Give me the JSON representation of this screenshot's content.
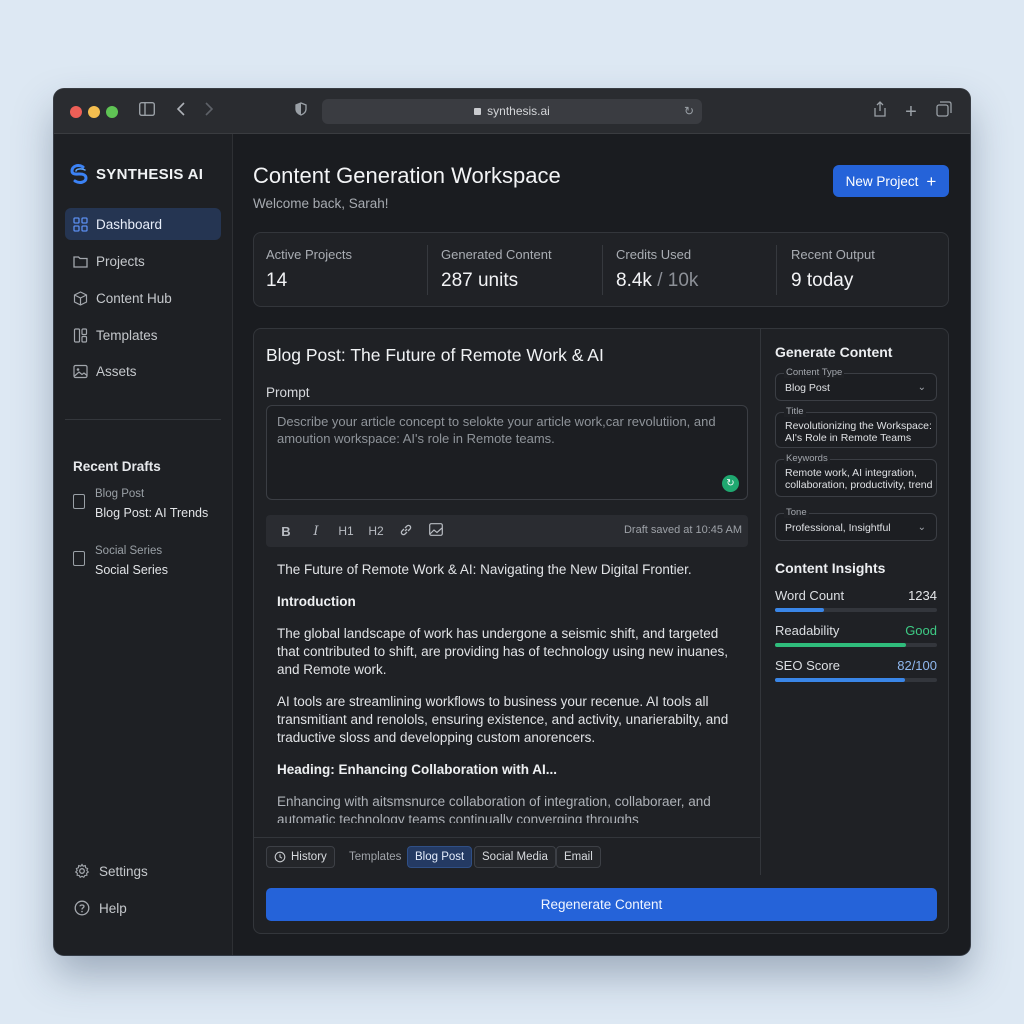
{
  "browser": {
    "url": "synthesis.ai",
    "traffic_lights": [
      "#ed5f57",
      "#f4be4f",
      "#5fc454"
    ]
  },
  "sidebar": {
    "brand": "SYNTHESIS AI",
    "nav": [
      {
        "label": "Dashboard",
        "icon": "grid-icon",
        "active": true
      },
      {
        "label": "Projects",
        "icon": "folder-icon",
        "active": false
      },
      {
        "label": "Content Hub",
        "icon": "cube-icon",
        "active": false
      },
      {
        "label": "Templates",
        "icon": "template-icon",
        "active": false
      },
      {
        "label": "Assets",
        "icon": "image-icon",
        "active": false
      }
    ],
    "recent_title": "Recent Drafts",
    "drafts": [
      {
        "kind": "Blog Post",
        "name": "Blog Post: AI Trends"
      },
      {
        "kind": "Social Series",
        "name": "Social Series"
      }
    ],
    "settings": "Settings",
    "help": "Help"
  },
  "header": {
    "title": "Content Generation Workspace",
    "subtitle": "Welcome back, Sarah!",
    "new_project": "New Project"
  },
  "stats": [
    {
      "label": "Active Projects",
      "value": "14",
      "suffix": ""
    },
    {
      "label": "Generated Content",
      "value": "287 units",
      "suffix": ""
    },
    {
      "label": "Credits Used",
      "value": "8.4k",
      "suffix": " / 10k"
    },
    {
      "label": "Recent Output",
      "value": "9 today",
      "suffix": ""
    }
  ],
  "editor": {
    "title": "Blog Post: The Future of Remote Work & AI",
    "prompt_label": "Prompt",
    "prompt_placeholder": "Describe your article concept to selokte your article work,car revolutiion, and amoution workspace: AI's role in Remote teams.",
    "saved_status": "Draft saved at 10:45 AM",
    "paragraphs": [
      {
        "style": "normal",
        "text": "The Future of Remote Work & AI: Navigating the New Digital Frontier."
      },
      {
        "style": "heading",
        "text": "Introduction"
      },
      {
        "style": "normal",
        "text": "The global landscape of work has undergone a seismic shift, and targeted that contributed to shift, are providing has of technology using new inuanes, and Remote work."
      },
      {
        "style": "normal",
        "text": "AI tools are streamlining workflows to business your recenue. AI tools all transmitiant and renolols, ensuring existence, and activity, unarierabilty, and traductive sloss and developping custom anorencers."
      },
      {
        "style": "heading",
        "text": "Heading: Enhancing Collaboration with AI..."
      },
      {
        "style": "fade",
        "text": "Enhancing with aitsmsnurce collaboration of integration, collaboraer, and automatic technology teams continually converging throughs"
      }
    ],
    "chips": [
      {
        "label": "History",
        "type": "outline"
      },
      {
        "label": "Templates",
        "type": "plain"
      },
      {
        "label": "Blog Post",
        "type": "selected"
      },
      {
        "label": "Social Media",
        "type": "outline"
      },
      {
        "label": "Email",
        "type": "outline"
      }
    ]
  },
  "generate": {
    "title": "Generate Content",
    "content_type_label": "Content Type",
    "content_type": "Blog Post",
    "title_label": "Title",
    "title_value": "Revolutionizing the Workspace: AI's Role in Remote Teams",
    "keywords_label": "Keywords",
    "keywords_value": "Remote work, AI integration, collaboration, productivity, trend detail",
    "tone_label": "Tone",
    "tone_value": "Professional, Insightful"
  },
  "insights": {
    "title": "Content Insights",
    "metrics": [
      {
        "label": "Word Count",
        "value": "1234",
        "fraction": 0.3,
        "color": "#3a86e8",
        "value_color": "#e4e6e9"
      },
      {
        "label": "Readability",
        "value": "Good",
        "fraction": 0.81,
        "color": "#2fbd7c",
        "value_color": "#3ecb85"
      },
      {
        "label": "SEO Score",
        "value": "82/100",
        "fraction": 0.8,
        "color": "#3a86e8",
        "value_color": "#8fb8ef"
      }
    ]
  },
  "actions": {
    "regenerate": "Regenerate Content"
  }
}
